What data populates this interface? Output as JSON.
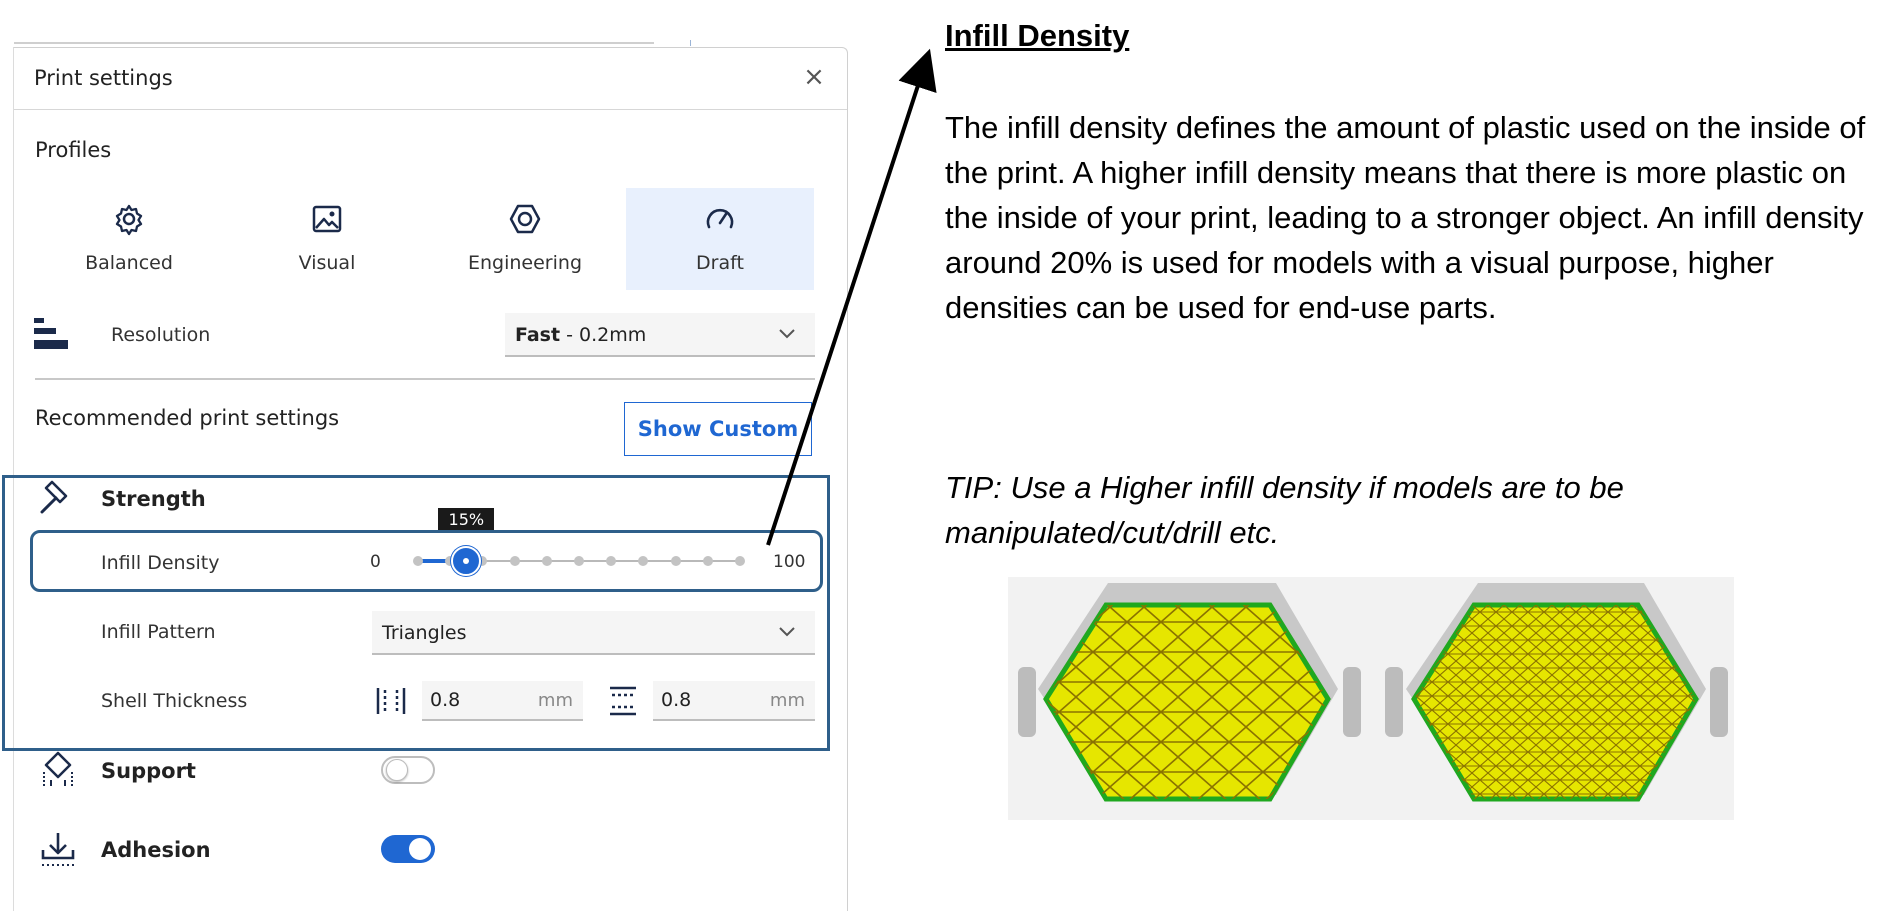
{
  "panel": {
    "title": "Print settings",
    "close_icon": "close-icon",
    "profiles_label": "Profiles",
    "profiles": [
      {
        "label": "Balanced",
        "icon": "gear-icon",
        "active": false
      },
      {
        "label": "Visual",
        "icon": "image-icon",
        "active": false
      },
      {
        "label": "Engineering",
        "icon": "hexagon-icon",
        "active": false
      },
      {
        "label": "Draft",
        "icon": "gauge-icon",
        "active": true
      }
    ],
    "resolution": {
      "label": "Resolution",
      "value_bold": "Fast",
      "value_rest": " - 0.2mm",
      "icon": "resolution-bars-icon"
    },
    "recommended_label": "Recommended print settings",
    "show_custom_label": "Show Custom",
    "strength": {
      "title": "Strength",
      "icon": "hammer-icon",
      "infill_density": {
        "label": "Infill Density",
        "min": "0",
        "max": "100",
        "value": 15,
        "tooltip": "15%"
      },
      "infill_pattern": {
        "label": "Infill Pattern",
        "value": "Triangles"
      },
      "shell_thickness": {
        "label": "Shell Thickness",
        "wall_value": "0.8",
        "wall_unit": "mm",
        "topbottom_value": "0.8",
        "topbottom_unit": "mm"
      }
    },
    "support": {
      "title": "Support",
      "icon": "support-icon",
      "enabled": false
    },
    "adhesion": {
      "title": "Adhesion",
      "icon": "adhesion-icon",
      "enabled": true
    }
  },
  "doc": {
    "heading": "Infill Density",
    "body": "The infill density defines the amount of plastic used on the inside of the print. A higher infill density means that there is more plastic on the inside of your print, leading to a stronger object. An infill density around 20% is used for models with a visual purpose, higher densities can be used for end-use parts.",
    "tip": "TIP: Use a Higher infill density if models are to be manipulated/cut/drill etc."
  },
  "colors": {
    "accent": "#1f67d2",
    "highlight_border": "#2f5f8a",
    "active_profile_bg": "#e8f0fd",
    "infill_yellow": "#e6e600",
    "infill_green": "#1fa81f"
  }
}
